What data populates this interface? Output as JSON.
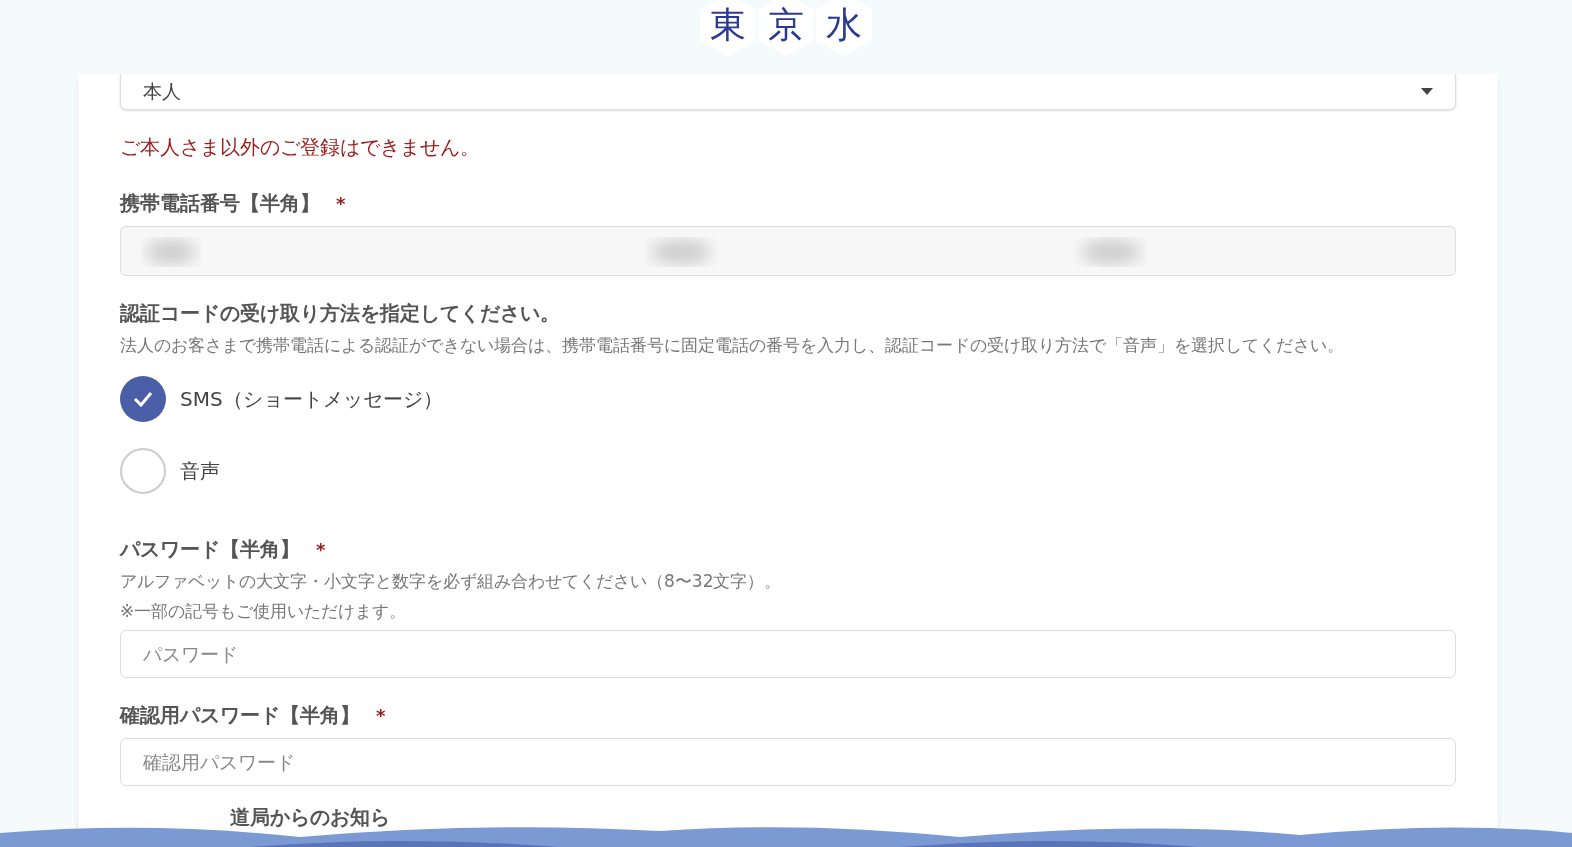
{
  "logo": {
    "characters": [
      "東",
      "京",
      "水"
    ]
  },
  "relationship_select": {
    "value": "本人"
  },
  "relationship_error": "ご本人さま以外のご登録はできません。",
  "phone": {
    "label": "携帯電話番号【半角】",
    "required_mark": "*"
  },
  "code_method": {
    "heading": "認証コードの受け取り方法を指定してください。",
    "note": "法人のお客さまで携帯電話による認証ができない場合は、携帯電話番号に固定電話の番号を入力し、認証コードの受け取り方法で「音声」を選択してください。",
    "options": [
      {
        "label": "SMS（ショートメッセージ）",
        "selected": true
      },
      {
        "label": "音声",
        "selected": false
      }
    ]
  },
  "password": {
    "label": "パスワード【半角】",
    "required_mark": "*",
    "hints": [
      "アルファベットの大文字・小文字と数字を必ず組み合わせてください（8〜32文字）。",
      "※一部の記号もご使用いただけます。"
    ],
    "placeholder": "パスワード"
  },
  "password_confirm": {
    "label": "確認用パスワード【半角】",
    "required_mark": "*",
    "placeholder": "確認用パスワード"
  },
  "next_section_partial": "道局からのお知ら"
}
